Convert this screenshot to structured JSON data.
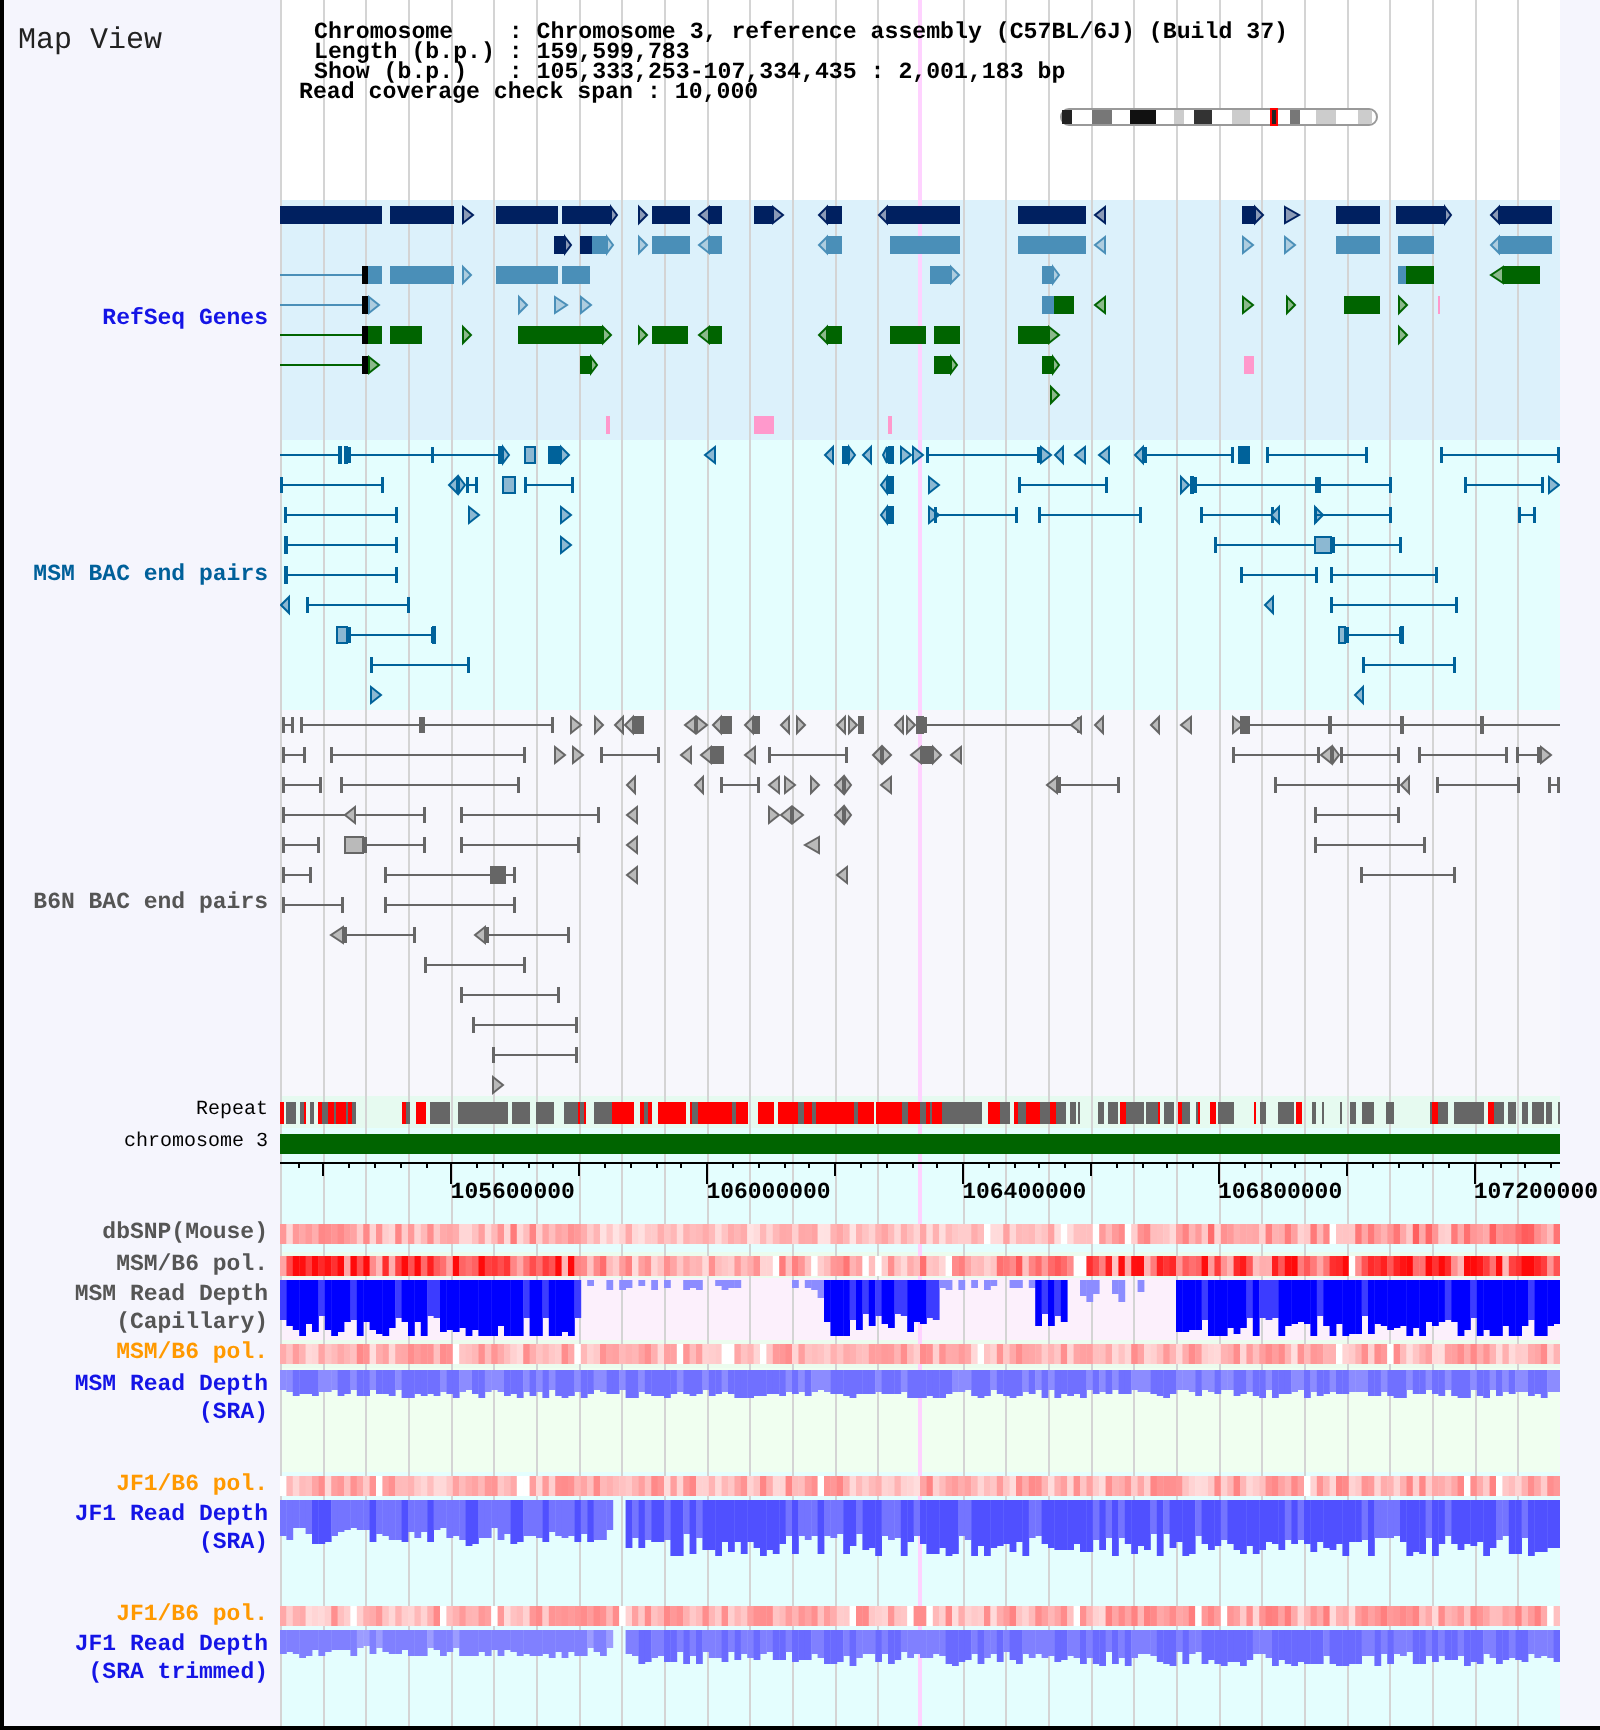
{
  "title": "Map View",
  "header": {
    "rows": [
      {
        "label": "Chromosome",
        "separator": ":",
        "value": "Chromosome 3, reference assembly (C57BL/6J) (Build 37)"
      },
      {
        "label": "Length (b.p.)",
        "separator": ":",
        "value": "159,599,783"
      },
      {
        "label": "Show (b.p.)",
        "separator": ":",
        "value": "105,333,253-107,334,435 : 2,001,183 bp"
      }
    ],
    "coverage": {
      "label": "Read coverage check span",
      "separator": ":",
      "value": "10,000"
    }
  },
  "tracks": [
    {
      "kind": "genes",
      "label": "RefSeq Genes",
      "color": "#1414e6"
    },
    {
      "kind": "pairs",
      "label": "MSM BAC end pairs",
      "color": "#00609a"
    },
    {
      "kind": "pairs",
      "label": "B6N BAC end pairs",
      "color": "#555555"
    },
    {
      "kind": "repeat",
      "label": "Repeat",
      "color": "#000000"
    },
    {
      "kind": "chromosome",
      "label": "chromosome 3",
      "color": "#000000"
    },
    {
      "kind": "ruler",
      "labels": [
        "105600000",
        "106000000",
        "106400000",
        "106800000",
        "107200000"
      ]
    },
    {
      "kind": "heatmap",
      "label": "dbSNP(Mouse)",
      "color": "#555555"
    },
    {
      "kind": "heatmap",
      "label": "MSM/B6 pol.",
      "color": "#555555"
    },
    {
      "kind": "depth",
      "label": "MSM Read Depth (Capillary)",
      "color": "#555555"
    },
    {
      "kind": "heatmap",
      "label": "MSM/B6 pol.",
      "color": "#ff9900"
    },
    {
      "kind": "depth",
      "label": "MSM Read Depth (SRA)",
      "color": "#1414e6"
    },
    {
      "kind": "heatmap",
      "label": "JF1/B6 pol.",
      "color": "#ff9900"
    },
    {
      "kind": "depth",
      "label": "JF1 Read Depth (SRA)",
      "color": "#1414e6"
    },
    {
      "kind": "heatmap",
      "label": "JF1/B6 pol.",
      "color": "#ff9900"
    },
    {
      "kind": "depth",
      "label": "JF1 Read Depth (SRA trimmed)",
      "color": "#1414e6"
    }
  ]
}
